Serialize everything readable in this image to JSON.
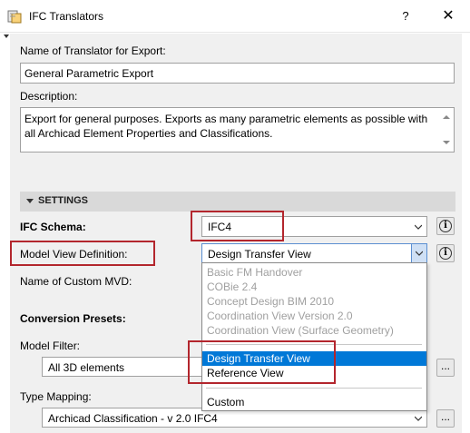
{
  "window": {
    "title": "IFC Translators",
    "help_label": "?",
    "close_label": "✕"
  },
  "export": {
    "name_label": "Name of Translator for Export:",
    "name_value": "General Parametric Export",
    "description_label": "Description:",
    "description_value": "Export for general purposes. Exports as many parametric elements as possible with all Archicad Element Properties and Classifications."
  },
  "settings": {
    "section_title": "SETTINGS",
    "schema_label": "IFC Schema:",
    "schema_value": "IFC4",
    "mvd_label": "Model View Definition:",
    "mvd_value": "Design Transfer View",
    "custom_mvd_label": "Name of Custom MVD:",
    "presets_label": "Conversion Presets:",
    "model_filter_label": "Model Filter:",
    "model_filter_value": "All 3D elements",
    "type_mapping_label": "Type Mapping:",
    "type_mapping_value": "Archicad Classification - v 2.0 IFC4",
    "dots_label": "..."
  },
  "mvd_options": {
    "disabled": [
      "Basic FM Handover",
      "COBie 2.4",
      "Concept Design BIM 2010",
      "Coordination View Version 2.0",
      "Coordination View (Surface Geometry)"
    ],
    "enabled": [
      "Design Transfer View",
      "Reference View"
    ],
    "selected": "Design Transfer View",
    "custom": "Custom"
  },
  "colors": {
    "highlight_box": "#b3262d",
    "selection": "#0078d7",
    "panel": "#f0f0f0"
  }
}
